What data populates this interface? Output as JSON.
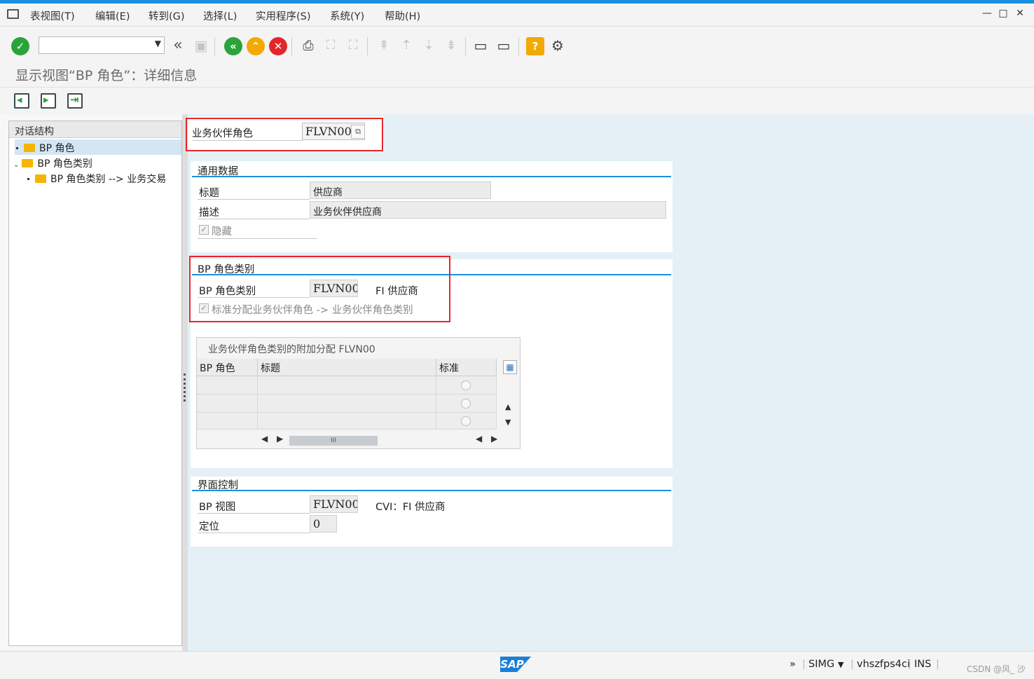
{
  "menu": {
    "items": [
      "表视图(T)",
      "编辑(E)",
      "转到(G)",
      "选择(L)",
      "实用程序(S)",
      "系统(Y)",
      "帮助(H)"
    ]
  },
  "window_controls": {
    "minimize": "—",
    "maximize": "□",
    "close": "✕"
  },
  "toolbar": {
    "command_field_value": "",
    "icons": [
      "enter-icon",
      "save-icon",
      "back-icon",
      "exit-icon",
      "cancel-icon",
      "print-icon",
      "find-icon",
      "find-next-icon",
      "first-page-icon",
      "prev-page-icon",
      "next-page-icon",
      "last-page-icon",
      "create-session-icon",
      "shortcut-icon",
      "help-icon",
      "settings-icon"
    ],
    "colors": {
      "enter": "#2aa33b",
      "back": "#2aa33b",
      "exit": "#f2a900",
      "cancel": "#e3262b",
      "help": "#f2a900"
    }
  },
  "page_title": "显示视图“BP 角色”：详细信息",
  "tree": {
    "header": "对话结构",
    "nodes": [
      {
        "label": "BP 角色",
        "selected": true
      },
      {
        "label": "BP 角色类别",
        "expanded": true
      },
      {
        "label": "BP 角色类别 --> 业务交易"
      }
    ]
  },
  "key": {
    "label": "业务伙伴角色",
    "value": "FLVN00"
  },
  "general": {
    "title": "通用数据",
    "heading_label": "标题",
    "heading_value": "供应商",
    "desc_label": "描述",
    "desc_value": "业务伙伴供应商",
    "hide_label": "隐藏"
  },
  "category": {
    "title": "BP 角色类别",
    "field_label": "BP 角色类别",
    "field_value": "FLVN00",
    "field_text": "FI 供应商",
    "std_assign_label": "标准分配业务伙伴角色 -> 业务伙伴角色类别"
  },
  "addl_table": {
    "title": "业务伙伴角色类别的附加分配 FLVN00",
    "columns": [
      "BP 角色",
      "标题",
      "标准"
    ],
    "hscroll_label": "III"
  },
  "ui_control": {
    "title": "界面控制",
    "view_label": "BP 视图",
    "view_value": "FLVN00",
    "view_text": "CVI：FI 供应商",
    "pos_label": "定位",
    "pos_value": "0"
  },
  "status": {
    "logo": "SAP",
    "expand": "»",
    "transaction": "SIMG",
    "server": "vhszfps4ci",
    "mode": "INS",
    "watermark": "CSDN @风_ 沙"
  }
}
